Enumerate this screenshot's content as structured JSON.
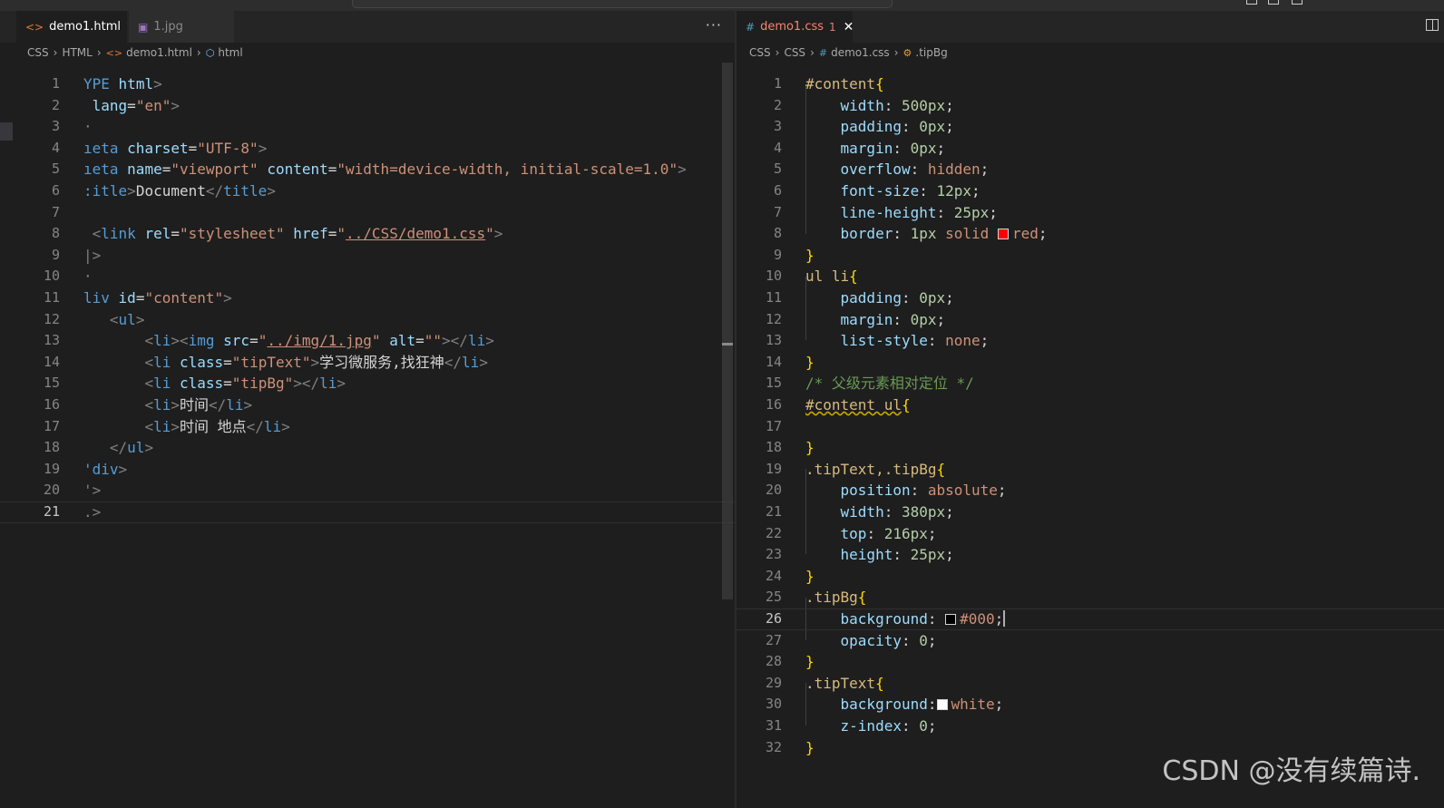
{
  "theme": {
    "bg": "#1e1e1e",
    "accent_error": "#f48771"
  },
  "topbar": {
    "menu_text": "",
    "command_center": ""
  },
  "left_pane": {
    "tabs": [
      {
        "label": "demo1.html",
        "icon": "html-file-icon",
        "active": true
      },
      {
        "label": "1.jpg",
        "icon": "image-file-icon",
        "active": false
      }
    ],
    "more_actions": "···",
    "breadcrumbs": [
      "CSS",
      "HTML",
      "demo1.html",
      "html"
    ],
    "lines": [
      {
        "n": "1",
        "tokens": [
          [
            "s-name",
            "YPE"
          ],
          [
            "s-text",
            " "
          ],
          [
            "s-attr",
            "html"
          ],
          [
            "s-tag",
            ">"
          ]
        ]
      },
      {
        "n": "2",
        "tokens": [
          [
            "s-attr",
            " lang"
          ],
          [
            "s-punc",
            "="
          ],
          [
            "s-str",
            "\"en\""
          ],
          [
            "s-tag",
            ">"
          ]
        ]
      },
      {
        "n": "3",
        "tokens": [
          [
            "s-tag",
            "·"
          ]
        ]
      },
      {
        "n": "4",
        "tokens": [
          [
            "s-name",
            "ıeta"
          ],
          [
            "s-text",
            " "
          ],
          [
            "s-attr",
            "charset"
          ],
          [
            "s-punc",
            "="
          ],
          [
            "s-str",
            "\"UTF-8\""
          ],
          [
            "s-tag",
            ">"
          ]
        ]
      },
      {
        "n": "5",
        "tokens": [
          [
            "s-name",
            "ıeta"
          ],
          [
            "s-text",
            " "
          ],
          [
            "s-attr",
            "name"
          ],
          [
            "s-punc",
            "="
          ],
          [
            "s-str",
            "\"viewport\""
          ],
          [
            "s-text",
            " "
          ],
          [
            "s-attr",
            "content"
          ],
          [
            "s-punc",
            "="
          ],
          [
            "s-str",
            "\"width=device-width, initial-scale=1.0\""
          ],
          [
            "s-tag",
            ">"
          ]
        ]
      },
      {
        "n": "6",
        "tokens": [
          [
            "s-name",
            ":itle"
          ],
          [
            "s-tag",
            ">"
          ],
          [
            "s-text",
            "Document"
          ],
          [
            "s-tag",
            "</"
          ],
          [
            "s-name",
            "title"
          ],
          [
            "s-tag",
            ">"
          ]
        ]
      },
      {
        "n": "7",
        "tokens": []
      },
      {
        "n": "8",
        "tokens": [
          [
            "s-tag",
            " <"
          ],
          [
            "s-name",
            "link"
          ],
          [
            "s-text",
            " "
          ],
          [
            "s-attr",
            "rel"
          ],
          [
            "s-punc",
            "="
          ],
          [
            "s-str",
            "\"stylesheet\""
          ],
          [
            "s-text",
            " "
          ],
          [
            "s-attr",
            "href"
          ],
          [
            "s-punc",
            "="
          ],
          [
            "s-str",
            "\""
          ],
          [
            "s-str u",
            "../CSS/demo1.css"
          ],
          [
            "s-str",
            "\""
          ],
          [
            "s-tag",
            ">"
          ]
        ]
      },
      {
        "n": "9",
        "tokens": [
          [
            "s-tag",
            "|>"
          ]
        ]
      },
      {
        "n": "10",
        "tokens": [
          [
            "s-tag",
            "·"
          ]
        ]
      },
      {
        "n": "11",
        "tokens": [
          [
            "s-name",
            "liv"
          ],
          [
            "s-text",
            " "
          ],
          [
            "s-attr",
            "id"
          ],
          [
            "s-punc",
            "="
          ],
          [
            "s-str",
            "\"content\""
          ],
          [
            "s-tag",
            ">"
          ]
        ]
      },
      {
        "n": "12",
        "tokens": [
          [
            "s-text",
            "   "
          ],
          [
            "s-tag",
            "<"
          ],
          [
            "s-name",
            "ul"
          ],
          [
            "s-tag",
            ">"
          ]
        ]
      },
      {
        "n": "13",
        "tokens": [
          [
            "s-text",
            "       "
          ],
          [
            "s-tag",
            "<"
          ],
          [
            "s-name",
            "li"
          ],
          [
            "s-tag",
            "><"
          ],
          [
            "s-name",
            "img"
          ],
          [
            "s-text",
            " "
          ],
          [
            "s-attr",
            "src"
          ],
          [
            "s-punc",
            "="
          ],
          [
            "s-str",
            "\""
          ],
          [
            "s-str u",
            "../img/1.jpg"
          ],
          [
            "s-str",
            "\""
          ],
          [
            "s-text",
            " "
          ],
          [
            "s-attr",
            "alt"
          ],
          [
            "s-punc",
            "="
          ],
          [
            "s-str",
            "\"\""
          ],
          [
            "s-tag",
            "></"
          ],
          [
            "s-name",
            "li"
          ],
          [
            "s-tag",
            ">"
          ]
        ]
      },
      {
        "n": "14",
        "tokens": [
          [
            "s-text",
            "       "
          ],
          [
            "s-tag",
            "<"
          ],
          [
            "s-name",
            "li"
          ],
          [
            "s-text",
            " "
          ],
          [
            "s-attr",
            "class"
          ],
          [
            "s-punc",
            "="
          ],
          [
            "s-str",
            "\"tipText\""
          ],
          [
            "s-tag",
            ">"
          ],
          [
            "s-text",
            "学习微服务,找狂神"
          ],
          [
            "s-tag",
            "</"
          ],
          [
            "s-name",
            "li"
          ],
          [
            "s-tag",
            ">"
          ]
        ]
      },
      {
        "n": "15",
        "tokens": [
          [
            "s-text",
            "       "
          ],
          [
            "s-tag",
            "<"
          ],
          [
            "s-name",
            "li"
          ],
          [
            "s-text",
            " "
          ],
          [
            "s-attr",
            "class"
          ],
          [
            "s-punc",
            "="
          ],
          [
            "s-str",
            "\"tipBg\""
          ],
          [
            "s-tag",
            "></"
          ],
          [
            "s-name",
            "li"
          ],
          [
            "s-tag",
            ">"
          ]
        ]
      },
      {
        "n": "16",
        "tokens": [
          [
            "s-text",
            "       "
          ],
          [
            "s-tag",
            "<"
          ],
          [
            "s-name",
            "li"
          ],
          [
            "s-tag",
            ">"
          ],
          [
            "s-text",
            "时间"
          ],
          [
            "s-tag",
            "</"
          ],
          [
            "s-name",
            "li"
          ],
          [
            "s-tag",
            ">"
          ]
        ]
      },
      {
        "n": "17",
        "tokens": [
          [
            "s-text",
            "       "
          ],
          [
            "s-tag",
            "<"
          ],
          [
            "s-name",
            "li"
          ],
          [
            "s-tag",
            ">"
          ],
          [
            "s-text",
            "时间 地点"
          ],
          [
            "s-tag",
            "</"
          ],
          [
            "s-name",
            "li"
          ],
          [
            "s-tag",
            ">"
          ]
        ]
      },
      {
        "n": "18",
        "tokens": [
          [
            "s-text",
            "   "
          ],
          [
            "s-tag",
            "</"
          ],
          [
            "s-name",
            "ul"
          ],
          [
            "s-tag",
            ">"
          ]
        ]
      },
      {
        "n": "19",
        "tokens": [
          [
            "s-name",
            "'div"
          ],
          [
            "s-tag",
            ">"
          ]
        ]
      },
      {
        "n": "20",
        "tokens": [
          [
            "s-tag",
            "'>"
          ]
        ]
      },
      {
        "n": "21",
        "tokens": [
          [
            "s-tag",
            ".>"
          ]
        ]
      }
    ],
    "current_line": "21"
  },
  "right_pane": {
    "tabs": [
      {
        "label": "demo1.css",
        "icon": "css-file-icon",
        "active": true,
        "badge": "1"
      }
    ],
    "breadcrumbs": [
      "CSS",
      "CSS",
      "demo1.css",
      ".tipBg"
    ],
    "lines": [
      {
        "n": "1",
        "tokens": [
          [
            "s-sel",
            "#content"
          ],
          [
            "s-brace",
            "{"
          ]
        ]
      },
      {
        "n": "2",
        "tokens": [
          [
            "s-text",
            "    "
          ],
          [
            "s-prop",
            "width"
          ],
          [
            "s-punc",
            ": "
          ],
          [
            "s-num",
            "500px"
          ],
          [
            "s-punc",
            ";"
          ]
        ]
      },
      {
        "n": "3",
        "tokens": [
          [
            "s-text",
            "    "
          ],
          [
            "s-prop",
            "padding"
          ],
          [
            "s-punc",
            ": "
          ],
          [
            "s-num",
            "0px"
          ],
          [
            "s-punc",
            ";"
          ]
        ]
      },
      {
        "n": "4",
        "tokens": [
          [
            "s-text",
            "    "
          ],
          [
            "s-prop",
            "margin"
          ],
          [
            "s-punc",
            ": "
          ],
          [
            "s-num",
            "0px"
          ],
          [
            "s-punc",
            ";"
          ]
        ]
      },
      {
        "n": "5",
        "tokens": [
          [
            "s-text",
            "    "
          ],
          [
            "s-prop",
            "overflow"
          ],
          [
            "s-punc",
            ": "
          ],
          [
            "s-val",
            "hidden"
          ],
          [
            "s-punc",
            ";"
          ]
        ]
      },
      {
        "n": "6",
        "tokens": [
          [
            "s-text",
            "    "
          ],
          [
            "s-prop",
            "font-size"
          ],
          [
            "s-punc",
            ": "
          ],
          [
            "s-num",
            "12px"
          ],
          [
            "s-punc",
            ";"
          ]
        ]
      },
      {
        "n": "7",
        "tokens": [
          [
            "s-text",
            "    "
          ],
          [
            "s-prop",
            "line-height"
          ],
          [
            "s-punc",
            ": "
          ],
          [
            "s-num",
            "25px"
          ],
          [
            "s-punc",
            ";"
          ]
        ]
      },
      {
        "n": "8",
        "tokens": [
          [
            "s-text",
            "    "
          ],
          [
            "s-prop",
            "border"
          ],
          [
            "s-punc",
            ": "
          ],
          [
            "s-num",
            "1px"
          ],
          [
            "s-text",
            " "
          ],
          [
            "s-val",
            "solid"
          ],
          [
            "s-text",
            " "
          ],
          [
            "swatch",
            "#ff0000"
          ],
          [
            "s-val",
            "red"
          ],
          [
            "s-punc",
            ";"
          ]
        ]
      },
      {
        "n": "9",
        "tokens": [
          [
            "s-brace",
            "}"
          ]
        ]
      },
      {
        "n": "10",
        "tokens": [
          [
            "s-sel",
            "ul li"
          ],
          [
            "s-brace",
            "{"
          ]
        ]
      },
      {
        "n": "11",
        "tokens": [
          [
            "s-text",
            "    "
          ],
          [
            "s-prop",
            "padding"
          ],
          [
            "s-punc",
            ": "
          ],
          [
            "s-num",
            "0px"
          ],
          [
            "s-punc",
            ";"
          ]
        ]
      },
      {
        "n": "12",
        "tokens": [
          [
            "s-text",
            "    "
          ],
          [
            "s-prop",
            "margin"
          ],
          [
            "s-punc",
            ": "
          ],
          [
            "s-num",
            "0px"
          ],
          [
            "s-punc",
            ";"
          ]
        ]
      },
      {
        "n": "13",
        "tokens": [
          [
            "s-text",
            "    "
          ],
          [
            "s-prop",
            "list-style"
          ],
          [
            "s-punc",
            ": "
          ],
          [
            "s-val",
            "none"
          ],
          [
            "s-punc",
            ";"
          ]
        ]
      },
      {
        "n": "14",
        "tokens": [
          [
            "s-brace",
            "}"
          ]
        ]
      },
      {
        "n": "15",
        "tokens": [
          [
            "s-com",
            "/* 父级元素相对定位 */"
          ]
        ]
      },
      {
        "n": "16",
        "tokens": [
          [
            "s-sel squig",
            "#content ul"
          ],
          [
            "s-brace",
            "{"
          ]
        ]
      },
      {
        "n": "17",
        "tokens": []
      },
      {
        "n": "18",
        "tokens": [
          [
            "s-brace",
            "}"
          ]
        ]
      },
      {
        "n": "19",
        "tokens": [
          [
            "s-sel",
            ".tipText,.tipBg"
          ],
          [
            "s-brace",
            "{"
          ]
        ]
      },
      {
        "n": "20",
        "tokens": [
          [
            "s-text",
            "    "
          ],
          [
            "s-prop",
            "position"
          ],
          [
            "s-punc",
            ": "
          ],
          [
            "s-val",
            "absolute"
          ],
          [
            "s-punc",
            ";"
          ]
        ]
      },
      {
        "n": "21",
        "tokens": [
          [
            "s-text",
            "    "
          ],
          [
            "s-prop",
            "width"
          ],
          [
            "s-punc",
            ": "
          ],
          [
            "s-num",
            "380px"
          ],
          [
            "s-punc",
            ";"
          ]
        ]
      },
      {
        "n": "22",
        "tokens": [
          [
            "s-text",
            "    "
          ],
          [
            "s-prop",
            "top"
          ],
          [
            "s-punc",
            ": "
          ],
          [
            "s-num",
            "216px"
          ],
          [
            "s-punc",
            ";"
          ]
        ]
      },
      {
        "n": "23",
        "tokens": [
          [
            "s-text",
            "    "
          ],
          [
            "s-prop",
            "height"
          ],
          [
            "s-punc",
            ": "
          ],
          [
            "s-num",
            "25px"
          ],
          [
            "s-punc",
            ";"
          ]
        ]
      },
      {
        "n": "24",
        "tokens": [
          [
            "s-brace",
            "}"
          ]
        ]
      },
      {
        "n": "25",
        "tokens": [
          [
            "s-sel",
            ".tipBg"
          ],
          [
            "s-brace",
            "{"
          ]
        ]
      },
      {
        "n": "26",
        "tokens": [
          [
            "s-text",
            "    "
          ],
          [
            "s-prop",
            "background"
          ],
          [
            "s-punc",
            ": "
          ],
          [
            "swatch",
            "#000000"
          ],
          [
            "s-val",
            "#000"
          ],
          [
            "s-punc",
            ";"
          ],
          [
            "caret",
            ""
          ]
        ]
      },
      {
        "n": "27",
        "tokens": [
          [
            "s-text",
            "    "
          ],
          [
            "s-prop",
            "opacity"
          ],
          [
            "s-punc",
            ": "
          ],
          [
            "s-num",
            "0"
          ],
          [
            "s-punc",
            ";"
          ]
        ]
      },
      {
        "n": "28",
        "tokens": [
          [
            "s-brace",
            "}"
          ]
        ]
      },
      {
        "n": "29",
        "tokens": [
          [
            "s-sel",
            ".tipText"
          ],
          [
            "s-brace",
            "{"
          ]
        ]
      },
      {
        "n": "30",
        "tokens": [
          [
            "s-text",
            "    "
          ],
          [
            "s-prop",
            "background"
          ],
          [
            "s-punc",
            ":"
          ],
          [
            "swatch",
            "#ffffff"
          ],
          [
            "s-val",
            "white"
          ],
          [
            "s-punc",
            ";"
          ]
        ]
      },
      {
        "n": "31",
        "tokens": [
          [
            "s-text",
            "    "
          ],
          [
            "s-prop",
            "z-index"
          ],
          [
            "s-punc",
            ": "
          ],
          [
            "s-num",
            "0"
          ],
          [
            "s-punc",
            ";"
          ]
        ]
      },
      {
        "n": "32",
        "tokens": [
          [
            "s-brace",
            "}"
          ]
        ]
      }
    ],
    "current_line": "26"
  },
  "watermark": "CSDN @没有续篇诗."
}
